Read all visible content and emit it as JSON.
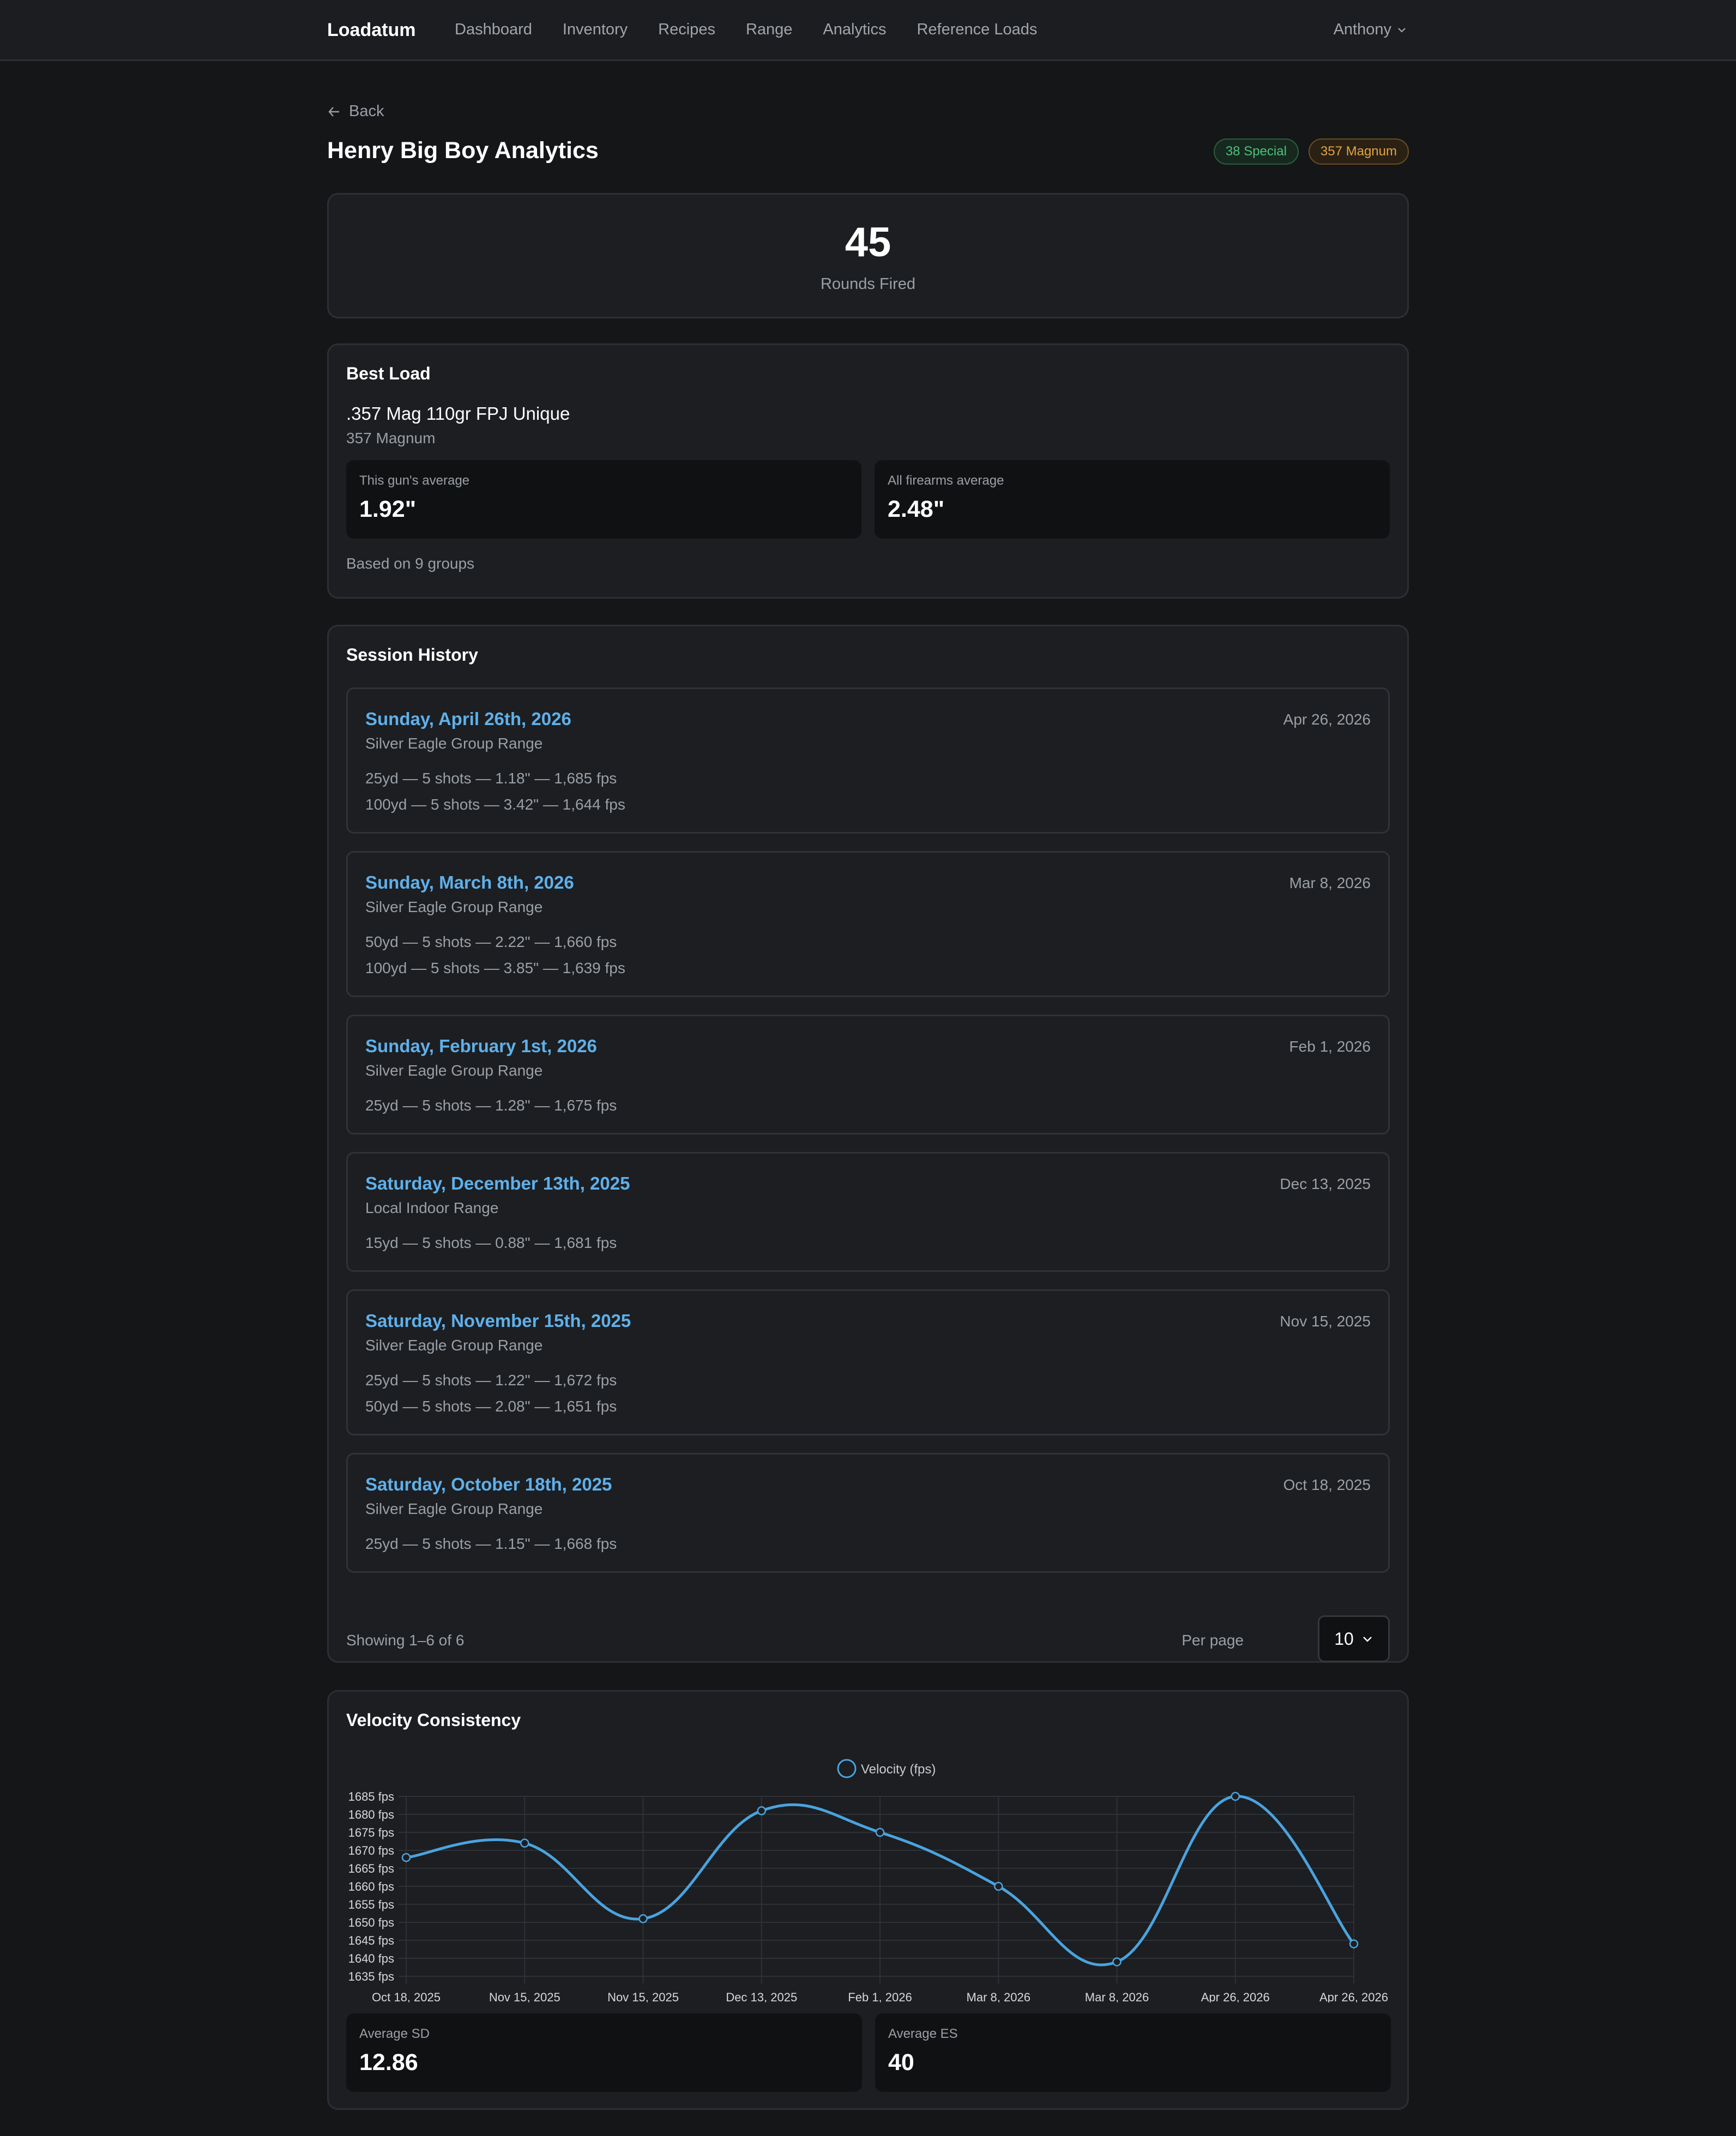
{
  "nav": {
    "brand": "Loadatum",
    "links": [
      "Dashboard",
      "Inventory",
      "Recipes",
      "Range",
      "Analytics",
      "Reference Loads"
    ],
    "user": "Anthony"
  },
  "page": {
    "back_label": "Back",
    "title": "Henry Big Boy Analytics",
    "badges": [
      "38 Special",
      "357 Magnum"
    ]
  },
  "rounds": {
    "value": "45",
    "label": "Rounds Fired"
  },
  "best_load": {
    "title": "Best Load",
    "name": ".357 Mag 110gr FPJ Unique",
    "caliber": "357 Magnum",
    "gun_avg_label": "This gun's average",
    "gun_avg_value": "1.92\"",
    "all_avg_label": "All firearms average",
    "all_avg_value": "2.48\"",
    "based_on": "Based on 9 groups"
  },
  "history": {
    "title": "Session History",
    "sessions": [
      {
        "title": "Sunday, April 26th, 2026",
        "date": "Apr 26, 2026",
        "location": "Silver Eagle Group Range",
        "groups": [
          "25yd — 5 shots — 1.18\" — 1,685 fps",
          "100yd — 5 shots — 3.42\" — 1,644 fps"
        ]
      },
      {
        "title": "Sunday, March 8th, 2026",
        "date": "Mar 8, 2026",
        "location": "Silver Eagle Group Range",
        "groups": [
          "50yd — 5 shots — 2.22\" — 1,660 fps",
          "100yd — 5 shots — 3.85\" — 1,639 fps"
        ]
      },
      {
        "title": "Sunday, February 1st, 2026",
        "date": "Feb 1, 2026",
        "location": "Silver Eagle Group Range",
        "groups": [
          "25yd — 5 shots — 1.28\" — 1,675 fps"
        ]
      },
      {
        "title": "Saturday, December 13th, 2025",
        "date": "Dec 13, 2025",
        "location": "Local Indoor Range",
        "groups": [
          "15yd — 5 shots — 0.88\" — 1,681 fps"
        ]
      },
      {
        "title": "Saturday, November 15th, 2025",
        "date": "Nov 15, 2025",
        "location": "Silver Eagle Group Range",
        "groups": [
          "25yd — 5 shots — 1.22\" — 1,672 fps",
          "50yd — 5 shots — 2.08\" — 1,651 fps"
        ]
      },
      {
        "title": "Saturday, October 18th, 2025",
        "date": "Oct 18, 2025",
        "location": "Silver Eagle Group Range",
        "groups": [
          "25yd — 5 shots — 1.15\" — 1,668 fps"
        ]
      }
    ],
    "showing": "Showing 1–6 of 6",
    "per_page_label": "Per page",
    "per_page_value": "10"
  },
  "velocity": {
    "title": "Velocity Consistency",
    "avg_sd_label": "Average SD",
    "avg_sd_value": "12.86",
    "avg_es_label": "Average ES",
    "avg_es_value": "40"
  },
  "chart_data": {
    "type": "line",
    "categories": [
      "Oct 18, 2025",
      "Nov 15, 2025",
      "Nov 15, 2025",
      "Dec 13, 2025",
      "Feb 1, 2026",
      "Mar 8, 2026",
      "Mar 8, 2026",
      "Apr 26, 2026",
      "Apr 26, 2026"
    ],
    "series": [
      {
        "name": "Velocity (fps)",
        "values": [
          1668,
          1672,
          1651,
          1681,
          1675,
          1660,
          1639,
          1685,
          1644
        ],
        "color": "#4aa3df"
      }
    ],
    "ylim": [
      1635,
      1685
    ],
    "yticks": [
      "1685 fps",
      "1680 fps",
      "1675 fps",
      "1670 fps",
      "1665 fps",
      "1660 fps",
      "1655 fps",
      "1650 fps",
      "1645 fps",
      "1640 fps",
      "1635 fps"
    ],
    "grid": true,
    "legend": "top-center",
    "xlabel": "",
    "ylabel": ""
  }
}
